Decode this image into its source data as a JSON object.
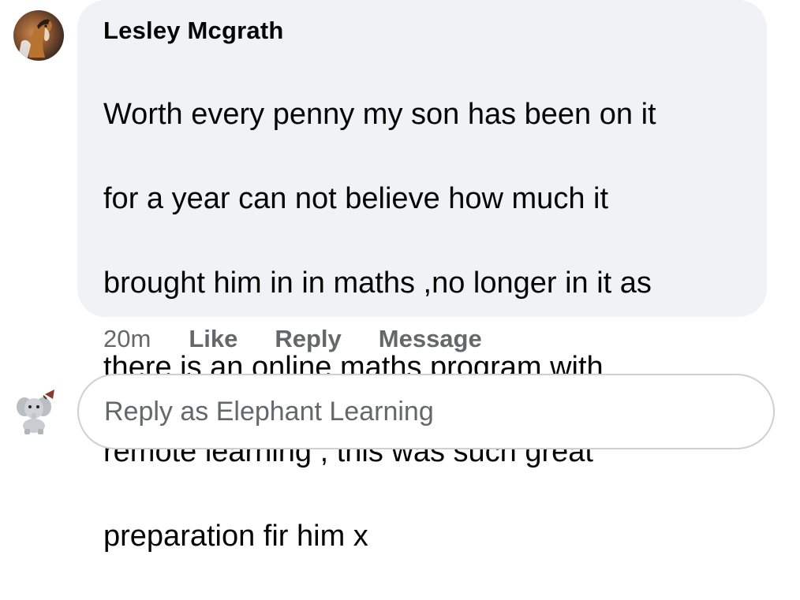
{
  "comment": {
    "author": "Lesley Mcgrath",
    "text_lines": [
      "Worth every penny my son has been on it",
      "for a year can not believe how much it",
      "brought him in in maths ,no longer in it as",
      "there is an online maths program with",
      "remote learning , this was such great",
      "preparation fir him x"
    ],
    "avatar_icon": "horse-avatar"
  },
  "actions": {
    "time": "20m",
    "like_label": "Like",
    "reply_label": "Reply",
    "message_label": "Message"
  },
  "reply_box": {
    "placeholder": "Reply as Elephant Learning",
    "value": "",
    "avatar_icon": "elephant-avatar"
  },
  "colors": {
    "bubble_bg": "#f0f2f5",
    "text": "#050505",
    "secondary_text": "#65676b",
    "input_border": "#ced0d4"
  }
}
